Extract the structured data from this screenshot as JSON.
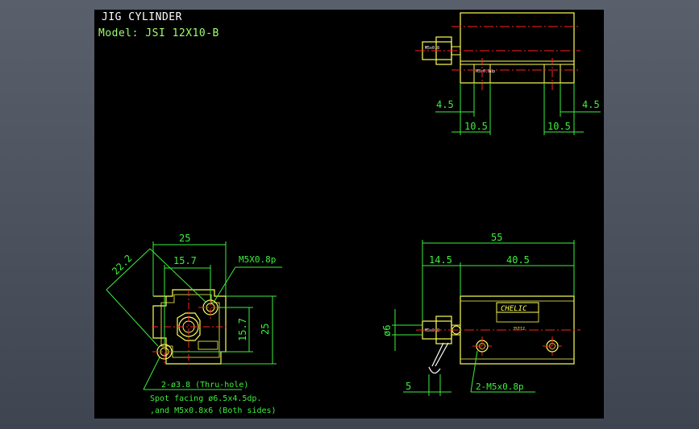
{
  "drawing": {
    "title": "JIG CYLINDER",
    "model": "Model: JSI 12X10-B"
  },
  "top_view": {
    "dim_left_small": "4.5",
    "dim_left_large": "10.5",
    "dim_right_large": "10.5",
    "dim_right_small": "4.5",
    "rod_label": "M5x0.8",
    "port_label": "M5x0.8dp"
  },
  "end_view": {
    "dim_width": "25",
    "dim_diagonal": "22.2",
    "dim_hole_spacing": "15.7",
    "dim_height_inner": "15.7",
    "dim_height": "25",
    "callout_thread": "M5X0.8p",
    "note_line1": "2-ø3.8 (Thru-hole)",
    "note_line2": "Spot facing ø6.5x4.5dp.",
    "note_line3": ",and M5x0.8x6 (Both sides)"
  },
  "side_view": {
    "dim_total": "55",
    "dim_rod": "14.5",
    "dim_body": "40.5",
    "dim_rod_dia": "ø6",
    "dim_wrench": "5",
    "callout_ports": "2-M5x0.8p",
    "brand_label": "CHELIC",
    "model_label": "JSI12",
    "rod_label": "M5x0.8"
  },
  "colors": {
    "outline": "#ffff55",
    "dimension": "#3cf03c",
    "centerline": "#ff2020",
    "text_white": "#ffffff",
    "background": "#000000"
  }
}
